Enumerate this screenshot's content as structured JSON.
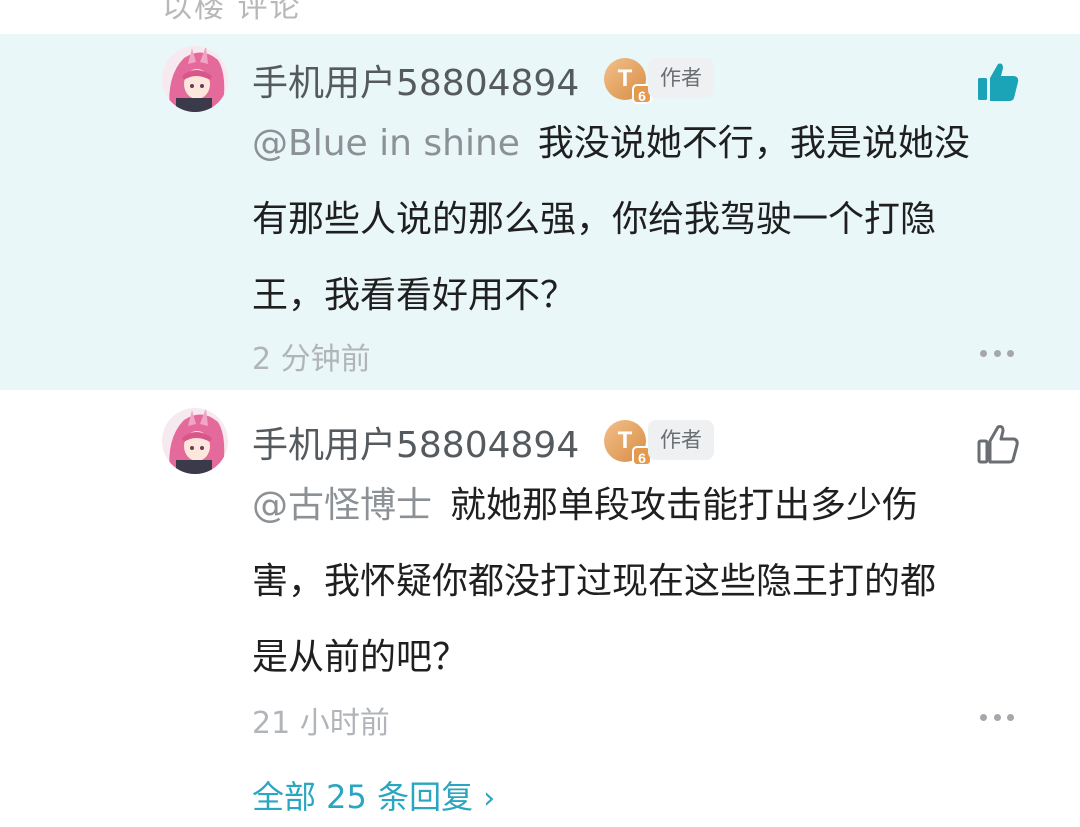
{
  "top_strip": {
    "text": "以楼 评论"
  },
  "comments": [
    {
      "username": "手机用户58804894",
      "level": "T",
      "level_sub": "6",
      "author_tag": "作者",
      "liked": true,
      "mention": "@Blue in shine",
      "lines": [
        "我没说她不行，我是说她没",
        "有那些人说的那么强，你给我驾驶一个打隐",
        "王，我看看好用不？"
      ],
      "time": "2 分钟前"
    },
    {
      "username": "手机用户58804894",
      "level": "T",
      "level_sub": "6",
      "author_tag": "作者",
      "liked": false,
      "mention": "@古怪博士",
      "lines": [
        "就她那单段攻击能打出多少伤",
        "害，我怀疑你都没打过现在这些隐王打的都",
        "是从前的吧？"
      ],
      "time": "21 小时前"
    }
  ],
  "reply_all": {
    "label": "全部 25 条回复"
  },
  "colors": {
    "highlight_bg": "#eaf7f9",
    "accent": "#2aa6c2",
    "liked_icon": "#1ba3b8"
  },
  "icons": [
    "like-filled-icon",
    "like-outline-icon",
    "more-icon",
    "chevron-right-icon",
    "level-badge"
  ]
}
